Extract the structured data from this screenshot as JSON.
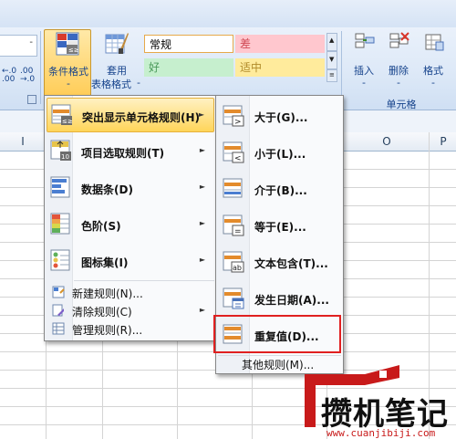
{
  "ribbon": {
    "conditional_format_label": "条件格式",
    "conditional_format_dropdown": "-",
    "format_as_table_label_1": "套用",
    "format_as_table_label_2": "表格格式",
    "format_as_table_dropdown": "-",
    "decimal_increase": "←.0 .00",
    "decimal_decrease": ".00 →.0",
    "styles": {
      "normal": "常规",
      "bad": "差",
      "good": "好",
      "neutral": "适中"
    },
    "insert_label": "插入",
    "delete_label": "删除",
    "format_label": "格式",
    "insert_dropdown": "-",
    "delete_dropdown": "-",
    "format_dropdown": "-",
    "cells_group_label": "单元格"
  },
  "columns": [
    "I",
    "O",
    "P"
  ],
  "main_menu": {
    "items": [
      {
        "label": "突出显示单元格规则(H)",
        "icon": "highlight-rules-icon",
        "has_submenu": true
      },
      {
        "label": "项目选取规则(T)",
        "icon": "top-bottom-rules-icon",
        "has_submenu": true
      },
      {
        "label": "数据条(D)",
        "icon": "data-bars-icon",
        "has_submenu": true
      },
      {
        "label": "色阶(S)",
        "icon": "color-scales-icon",
        "has_submenu": true
      },
      {
        "label": "图标集(I)",
        "icon": "icon-sets-icon",
        "has_submenu": true
      }
    ],
    "small_items": [
      {
        "label": "新建规则(N)...",
        "icon": "new-rule-icon"
      },
      {
        "label": "清除规则(C)",
        "icon": "clear-rules-icon",
        "has_submenu": true
      },
      {
        "label": "管理规则(R)...",
        "icon": "manage-rules-icon"
      }
    ]
  },
  "sub_menu": {
    "items": [
      {
        "label": "大于(G)...",
        "icon": "greater-than-icon"
      },
      {
        "label": "小于(L)...",
        "icon": "less-than-icon"
      },
      {
        "label": "介于(B)...",
        "icon": "between-icon"
      },
      {
        "label": "等于(E)...",
        "icon": "equal-to-icon"
      },
      {
        "label": "文本包含(T)...",
        "icon": "text-contains-icon"
      },
      {
        "label": "发生日期(A)...",
        "icon": "date-occurring-icon"
      },
      {
        "label": "重复值(D)...",
        "icon": "duplicate-values-icon"
      }
    ],
    "more_rules": "其他规则(M)..."
  },
  "watermark": {
    "title": "攒机笔记",
    "url": "www.cuanjibiji.com"
  },
  "colors": {
    "highlight": "#ffd55a",
    "annotation_red": "#e02020",
    "ribbon_text": "#15428b"
  }
}
